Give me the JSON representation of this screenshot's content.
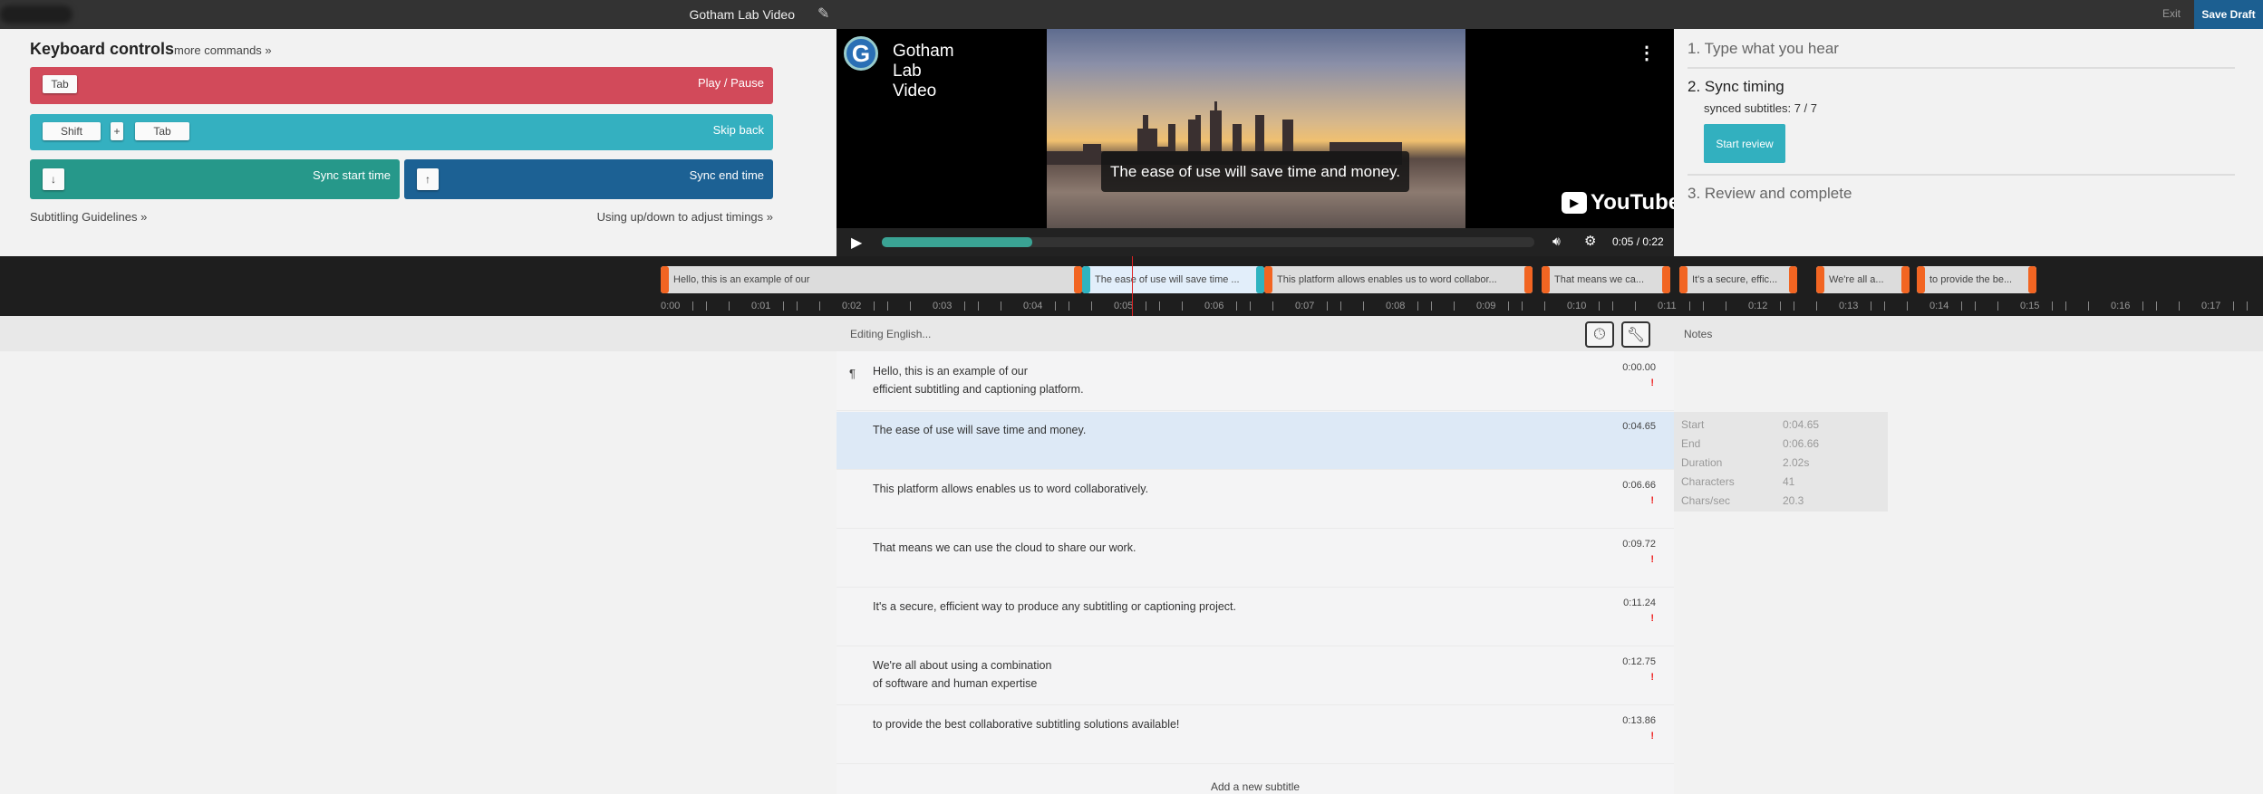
{
  "topbar": {
    "project_title": "Gotham Lab Video",
    "exit": "Exit",
    "save_draft": "Save Draft"
  },
  "keyboard": {
    "title": "Keyboard controls",
    "more": "more commands »",
    "play_pause": {
      "keys": [
        "Tab"
      ],
      "label": "Play / Pause",
      "color": "#d24a5a"
    },
    "skip_back": {
      "keys": [
        "Shift",
        "+",
        "Tab"
      ],
      "label": "Skip back",
      "color": "#34b0c0"
    },
    "sync_start": {
      "key": "↓",
      "label": "Sync start time",
      "color": "#26988a"
    },
    "sync_end": {
      "key": "↑",
      "label": "Sync end time",
      "color": "#1c6194"
    },
    "guidelines": "Subtitling Guidelines »",
    "updown": "Using up/down to adjust timings »"
  },
  "video": {
    "channel_logo": "G",
    "title": "Gotham Lab Video",
    "caption": "The ease of use will save time and money.",
    "brand": "YouTube",
    "time": "0:05 / 0:22",
    "progress_percent": 23
  },
  "steps": {
    "s1": "1. Type what you hear",
    "s2": "2. Sync timing",
    "synced": "synced subtitles: 7 / 7",
    "review": "Start review",
    "s3": "3. Review and complete"
  },
  "timeline": {
    "playhead": 5.2,
    "seconds": 17,
    "blocks": [
      {
        "text": "Hello, this is an example of our",
        "start": 0,
        "end": 4.65
      },
      {
        "text": "The ease of use will save time ...",
        "start": 4.65,
        "end": 6.66,
        "selected": true
      },
      {
        "text": "This platform allows enables us to word collabor...",
        "start": 6.66,
        "end": 9.62
      },
      {
        "text": "That means we ca...",
        "start": 9.72,
        "end": 11.14
      },
      {
        "text": "It's a secure, effic...",
        "start": 11.24,
        "end": 12.54
      },
      {
        "text": "We're all a...",
        "start": 12.75,
        "end": 13.78
      },
      {
        "text": "to provide the be...",
        "start": 13.86,
        "end": 15.18
      }
    ]
  },
  "editor": {
    "header": "Editing English...",
    "notes": "Notes",
    "add": "Add a new subtitle",
    "rows": [
      {
        "text": "Hello, this is an example of our\nefficient subtitling and captioning platform.",
        "time": "0:00.00",
        "warn": "!"
      },
      {
        "text": "The ease of use will save time and money.",
        "time": "0:04.65",
        "warn": "",
        "selected": true
      },
      {
        "text": "This platform allows enables us to word collaboratively.",
        "time": "0:06.66",
        "warn": "!"
      },
      {
        "text": "That means we can use the cloud to share our work.",
        "time": "0:09.72",
        "warn": "!"
      },
      {
        "text": "It's a secure, efficient way to produce any subtitling or captioning project.",
        "time": "0:11.24",
        "warn": "!"
      },
      {
        "text": "We're all about using a combination\nof software and human expertise",
        "time": "0:12.75",
        "warn": "!"
      },
      {
        "text": "to provide the best collaborative subtitling solutions available!",
        "time": "0:13.86",
        "warn": "!"
      }
    ]
  },
  "info": [
    [
      "Start",
      "0:04.65"
    ],
    [
      "End",
      "0:06.66"
    ],
    [
      "Duration",
      "2.02s"
    ],
    [
      "Characters",
      "41"
    ],
    [
      "Chars/sec",
      "20.3"
    ]
  ]
}
